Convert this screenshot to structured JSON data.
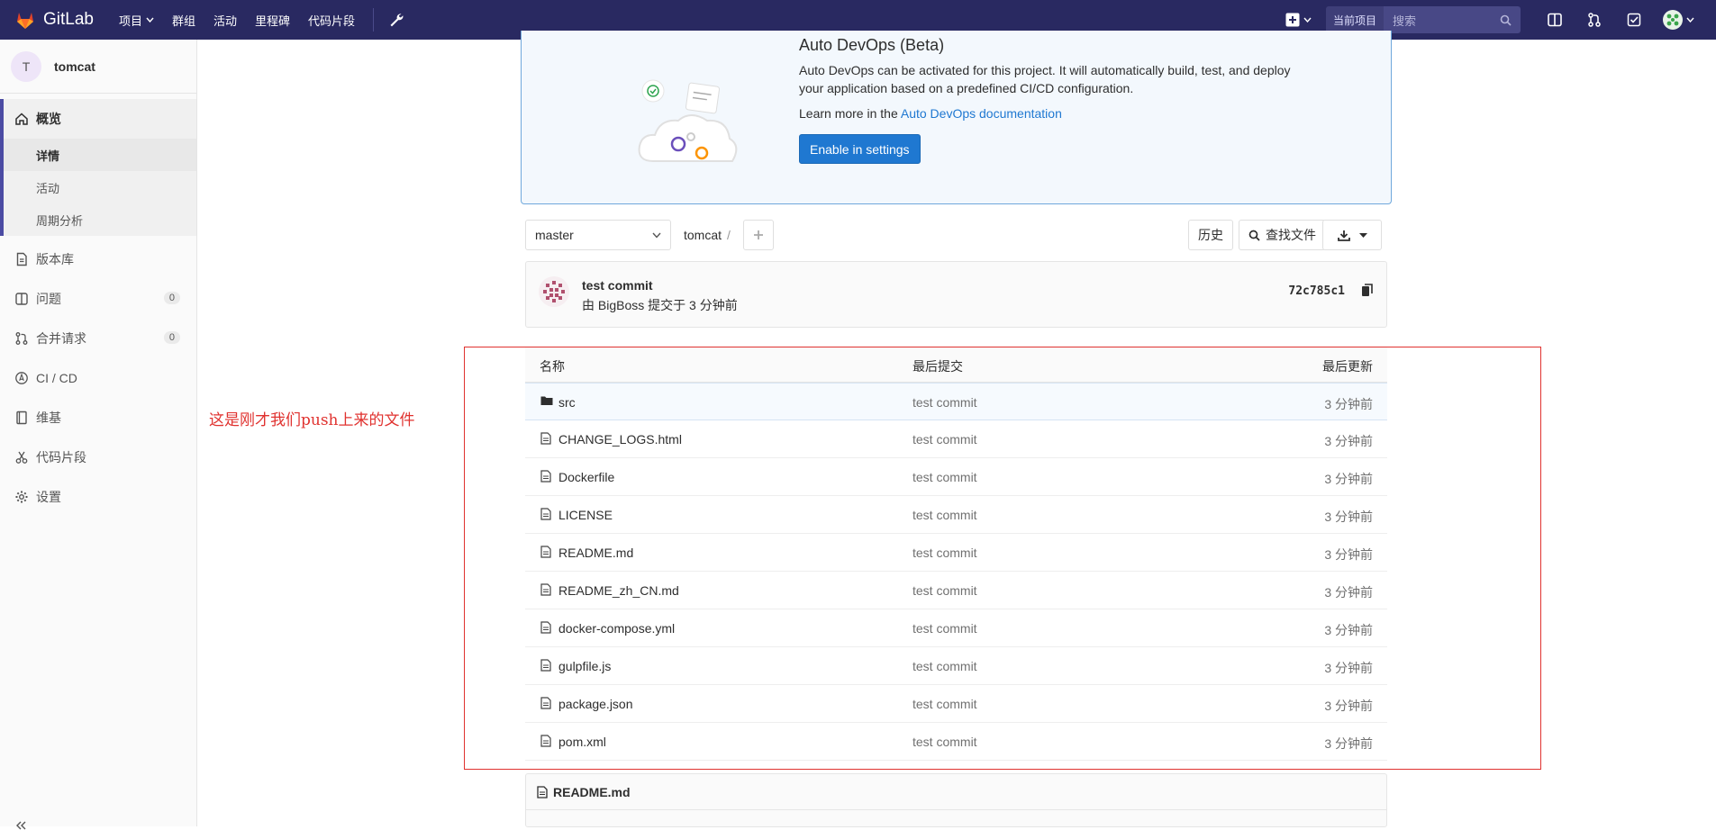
{
  "navbar": {
    "brand": "GitLab",
    "menu": [
      {
        "label": "项目",
        "dropdown": true
      },
      {
        "label": "群组"
      },
      {
        "label": "活动"
      },
      {
        "label": "里程碑"
      },
      {
        "label": "代码片段"
      }
    ],
    "search_scope": "当前项目",
    "search_placeholder": "搜索",
    "colors": {
      "bg": "#292961",
      "logo": "#e24329"
    }
  },
  "sidebar": {
    "project_initial": "T",
    "project_name": "tomcat",
    "overview": {
      "label": "概览",
      "sub": [
        "详情",
        "活动",
        "周期分析"
      ]
    },
    "items": [
      {
        "label": "版本库",
        "icon": "document-icon"
      },
      {
        "label": "问题",
        "icon": "issues-icon",
        "count": "0"
      },
      {
        "label": "合并请求",
        "icon": "merge-request-icon",
        "count": "0"
      },
      {
        "label": "CI / CD",
        "icon": "rocket-icon"
      },
      {
        "label": "维基",
        "icon": "book-icon"
      },
      {
        "label": "代码片段",
        "icon": "scissors-icon"
      },
      {
        "label": "设置",
        "icon": "gear-icon"
      }
    ]
  },
  "devops": {
    "title": "Auto DevOps (Beta)",
    "text": "Auto DevOps can be activated for this project. It will automatically build, test, and deploy your application based on a predefined CI/CD configuration.",
    "learn_prefix": "Learn more in the",
    "learn_link": "Auto DevOps documentation",
    "button": "Enable in settings"
  },
  "toolbar": {
    "branch": "master",
    "path": "tomcat",
    "history": "历史",
    "find_file": "查找文件"
  },
  "commit": {
    "title": "test commit",
    "meta": "由 BigBoss 提交于 3 分钟前",
    "sha": "72c785c1"
  },
  "files": {
    "headers": {
      "name": "名称",
      "last_commit": "最后提交",
      "last_update": "最后更新"
    },
    "rows": [
      {
        "name": "src",
        "type": "folder",
        "commit": "test commit",
        "date": "3 分钟前"
      },
      {
        "name": "CHANGE_LOGS.html",
        "type": "file",
        "commit": "test commit",
        "date": "3 分钟前"
      },
      {
        "name": "Dockerfile",
        "type": "file",
        "commit": "test commit",
        "date": "3 分钟前"
      },
      {
        "name": "LICENSE",
        "type": "file",
        "commit": "test commit",
        "date": "3 分钟前"
      },
      {
        "name": "README.md",
        "type": "file",
        "commit": "test commit",
        "date": "3 分钟前"
      },
      {
        "name": "README_zh_CN.md",
        "type": "file",
        "commit": "test commit",
        "date": "3 分钟前"
      },
      {
        "name": "docker-compose.yml",
        "type": "file",
        "commit": "test commit",
        "date": "3 分钟前"
      },
      {
        "name": "gulpfile.js",
        "type": "file",
        "commit": "test commit",
        "date": "3 分钟前"
      },
      {
        "name": "package.json",
        "type": "file",
        "commit": "test commit",
        "date": "3 分钟前"
      },
      {
        "name": "pom.xml",
        "type": "file",
        "commit": "test commit",
        "date": "3 分钟前"
      }
    ]
  },
  "annotation": {
    "text": "这是刚才我们push上来的文件",
    "color": "#e0322f"
  },
  "readme": {
    "title": "README.md"
  }
}
